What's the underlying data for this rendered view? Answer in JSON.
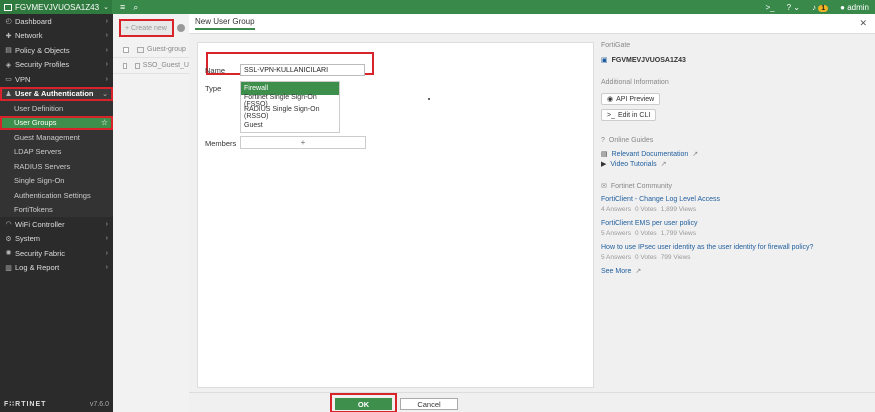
{
  "topbar": {
    "device_name": "FGVMEVJVUOSA1Z43",
    "icons": [
      "menu-icon",
      "search-icon",
      "terminal-icon",
      "help-icon",
      "bell-icon",
      "user-icon"
    ],
    "notification_count": "1",
    "user": "admin"
  },
  "sidebar": {
    "items": [
      {
        "label": "Dashboard",
        "icon": "dashboard-icon"
      },
      {
        "label": "Network",
        "icon": "network-icon"
      },
      {
        "label": "Policy & Objects",
        "icon": "policy-icon"
      },
      {
        "label": "Security Profiles",
        "icon": "shield-icon"
      },
      {
        "label": "VPN",
        "icon": "vpn-icon"
      },
      {
        "label": "User & Authentication",
        "icon": "user-icon"
      }
    ],
    "subitems": [
      "User Definition",
      "User Groups",
      "Guest Management",
      "LDAP Servers",
      "RADIUS Servers",
      "Single Sign-On",
      "Authentication Settings",
      "FortiTokens"
    ],
    "items_after": [
      {
        "label": "WiFi Controller",
        "icon": "wifi-icon"
      },
      {
        "label": "System",
        "icon": "gear-icon"
      },
      {
        "label": "Security Fabric",
        "icon": "fabric-icon"
      },
      {
        "label": "Log & Report",
        "icon": "log-icon"
      }
    ],
    "logo": "F∷RTINET",
    "version": "v7.6.0"
  },
  "list": {
    "create_label": "+ Create new",
    "rows": [
      "Guest-group",
      "SSO_Guest_U"
    ]
  },
  "dialog": {
    "title": "New User Group",
    "name_label": "Name",
    "name_value": "SSL-VPN-KULLANICILARI",
    "type_label": "Type",
    "type_options": [
      "Firewall",
      "Fortinet Single Sign-On (FSSO)",
      "RADIUS Single Sign-On (RSSO)",
      "Guest"
    ],
    "members_label": "Members",
    "members_add": "+",
    "ok_label": "OK",
    "cancel_label": "Cancel"
  },
  "info": {
    "fortigate_title": "FortiGate",
    "device_link": "FGVMEVJVUOSA1Z43",
    "additional_title": "Additional Information",
    "api_preview": "API Preview",
    "edit_cli": "Edit in CLI",
    "guides_title": "Online Guides",
    "guide_links": [
      "Relevant Documentation",
      "Video Tutorials"
    ],
    "community_title": "Fortinet Community",
    "community": [
      {
        "title": "FortiClient - Change Log Level Access",
        "answers": "4 Answers",
        "votes": "0 Votes",
        "views": "1,899 Views"
      },
      {
        "title": "FortiClient EMS per user policy",
        "answers": "5 Answers",
        "votes": "0 Votes",
        "views": "1,799 Views"
      },
      {
        "title": "How to use IPsec user identity as the user identity for firewall policy?",
        "answers": "5 Answers",
        "votes": "0 Votes",
        "views": "799 Views"
      }
    ],
    "see_more": "See More"
  },
  "colors": {
    "accent": "#39894a",
    "highlight": "#d8232a",
    "sidebar": "#2b2b2b"
  }
}
